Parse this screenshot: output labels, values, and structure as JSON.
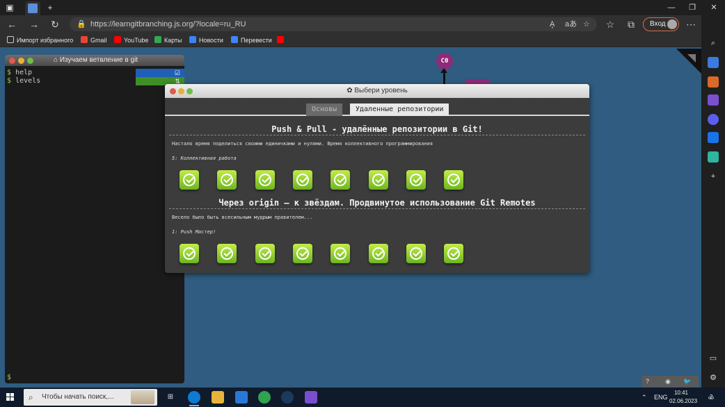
{
  "browser": {
    "url_host": "https://learngitbranching.js.org",
    "url_path": "/?locale=ru_RU",
    "login_label": "Вход",
    "reader_icon": "A̧",
    "translate_icon": "aあ"
  },
  "bookmarks": [
    {
      "label": "Импорт избранного",
      "color": "#e5e5e5"
    },
    {
      "label": "Gmail",
      "color": "#ea4335"
    },
    {
      "label": "YouTube",
      "color": "#ff0000"
    },
    {
      "label": "Карты",
      "color": "#34a853"
    },
    {
      "label": "Новости",
      "color": "#3b82f6"
    },
    {
      "label": "Перевести",
      "color": "#4285f4"
    }
  ],
  "terminal": {
    "title": "Изучаем ветвление в git",
    "lines": [
      {
        "prompt": "$",
        "cmd": "help",
        "badge": "☑",
        "badge_color": "#1f5fb8"
      },
      {
        "prompt": "$",
        "cmd": "levels",
        "badge": "⇅",
        "badge_color": "#3f8f26"
      }
    ],
    "bottom_prompt": "$"
  },
  "graph": {
    "node_label": "C0"
  },
  "modal": {
    "title": "✿ Выбери уровень",
    "tabs": [
      {
        "label": "Основы",
        "active": false
      },
      {
        "label": "Удаленные репозитории",
        "active": true
      }
    ],
    "sections": [
      {
        "title": "Push & Pull - удалённые репозитории в Git!",
        "desc": "Настало время поделиться своими единичками и нулями. Время коллективного программирования",
        "sub": "5: Коллективная работа",
        "levels_completed": 8
      },
      {
        "title": "Через origin – к звёздам. Продвинутое использование Git Remotes",
        "desc": "Весело было быть всесильным мудрым правителем...",
        "sub": "1: Push Мастер!",
        "levels_completed": 8
      }
    ]
  },
  "widget": {
    "help": "?",
    "globe": "◉",
    "twitter": "🐦"
  },
  "taskbar": {
    "search_placeholder": "Чтобы начать поиск,...",
    "lang": "ENG",
    "time": "10:41",
    "date": "02.06.2023",
    "notifications": "2"
  },
  "colors": {
    "page_bg": "#2f5c80",
    "level_green": "#8fd14f",
    "node_purple": "#8d2b78"
  }
}
